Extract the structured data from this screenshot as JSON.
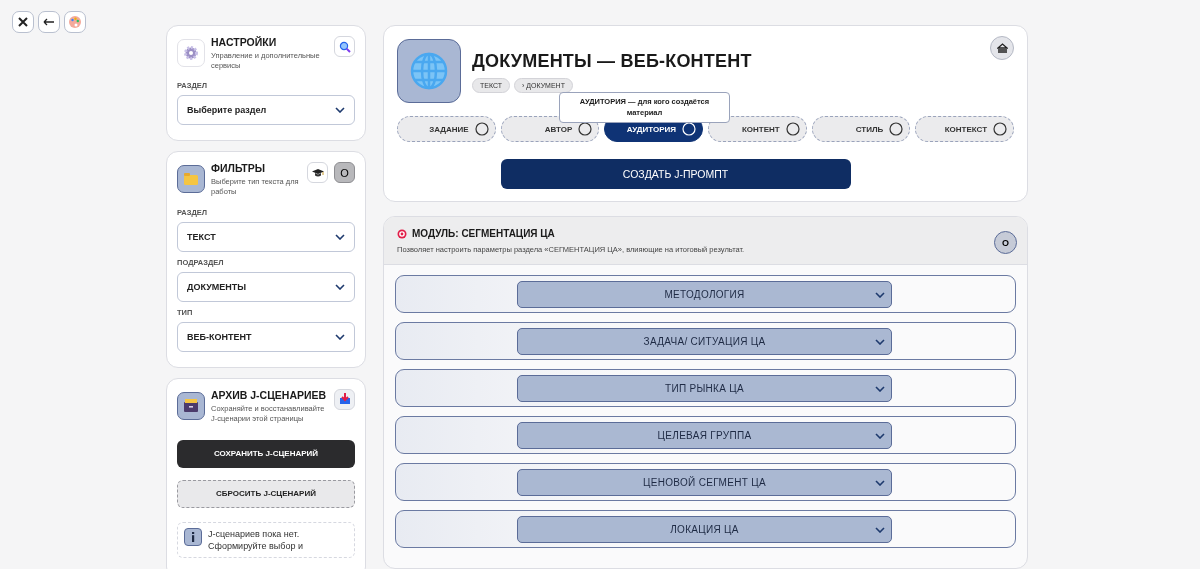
{
  "settings": {
    "title": "НАСТРОЙКИ",
    "subtitle": "Управление и дополнительные сервисы",
    "field_label": "РАЗДЕЛ",
    "select": {
      "placeholder": "Выберите раздел"
    }
  },
  "filters": {
    "title": "ФИЛЬТРЫ",
    "subtitle": "Выберите тип текста для работы",
    "toggle": "O",
    "fields": [
      {
        "label": "РАЗДЕЛ",
        "value": "ТЕКСТ"
      },
      {
        "label": "ПОДРАЗДЕЛ",
        "value": "ДОКУМЕНТЫ"
      },
      {
        "label": "ТИП",
        "value": "ВЕБ-КОНТЕНТ"
      }
    ]
  },
  "archive": {
    "title": "АРХИВ J-СЦЕНАРИЕВ",
    "subtitle": "Сохраняйте и восстанавливайте J-сценарии этой страницы",
    "save_button": "СОХРАНИТЬ J-СЦЕНАРИЙ",
    "reset_button": "СБРОСИТЬ J-СЦЕНАРИЙ",
    "info": "J-сценариев пока нет. Сформируйте выбор и"
  },
  "header": {
    "title": "ДОКУМЕНТЫ — ВЕБ-КОНТЕНТ",
    "breadcrumbs": [
      "ТЕКСТ",
      "› ДОКУМЕНТ"
    ],
    "tooltip": "АУДИТОРИЯ — для кого создаётся материал",
    "tabs": [
      {
        "label": "ЗАДАНИЕ",
        "selected": false
      },
      {
        "label": "АВТОР",
        "selected": false
      },
      {
        "label": "АУДИТОРИЯ",
        "selected": true
      },
      {
        "label": "КОНТЕНТ",
        "selected": false
      },
      {
        "label": "СТИЛЬ",
        "selected": false
      },
      {
        "label": "КОНТЕКСТ",
        "selected": false
      }
    ],
    "create_button": "СОЗДАТЬ J-ПРОМПТ"
  },
  "module": {
    "title": "МОДУЛЬ: СЕГМЕНТАЦИЯ ЦА",
    "description": "Позволяет настроить параметры раздела «СЕГМЕНТАЦИЯ ЦА», влияющие на итоговый результат.",
    "toggle": "O",
    "sections": [
      {
        "label": "МЕТОДОЛОГИЯ"
      },
      {
        "label": "ЗАДАЧА/ СИТУАЦИЯ ЦА"
      },
      {
        "label": "ТИП РЫНКА ЦА"
      },
      {
        "label": "ЦЕЛЕВАЯ ГРУППА"
      },
      {
        "label": "ЦЕНОВОЙ СЕГМЕНТ ЦА"
      },
      {
        "label": "ЛОКАЦИЯ ЦА"
      }
    ]
  }
}
